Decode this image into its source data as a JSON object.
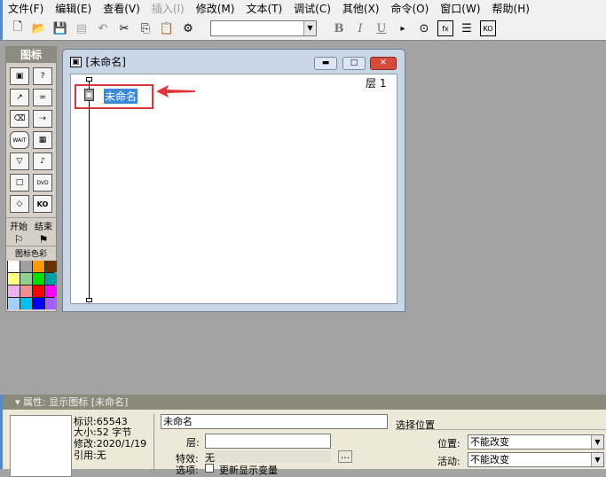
{
  "menu": [
    "文件(F)",
    "编辑(E)",
    "查看(V)",
    "插入(I)",
    "修改(M)",
    "文本(T)",
    "调试(C)",
    "其他(X)",
    "命令(O)",
    "窗口(W)",
    "帮助(H)"
  ],
  "toolbar": {
    "bold": "B",
    "italic": "I",
    "underline": "U",
    "font_value": ""
  },
  "palette": {
    "title": "图标",
    "start": "开始",
    "end": "结束",
    "color_title": "图标色彩",
    "icons": [
      "display",
      "interaction",
      "motion",
      "calculation",
      "erase",
      "navigate",
      "wait",
      "framework",
      "decision",
      "sound",
      "digital-movie",
      "video",
      "map",
      "knowledge-object"
    ],
    "colors": [
      "#ffffff",
      "#a0a0a0",
      "#ff9900",
      "#6b3300",
      "#ffff80",
      "#90d090",
      "#00e000",
      "#00a0a0",
      "#f0b0f0",
      "#f09090",
      "#ff0000",
      "#ff00ff",
      "#a0d0ff",
      "#00c0f0",
      "#0000ff",
      "#a060ff"
    ]
  },
  "flow_window": {
    "title": "[未命名]",
    "layer_label": "层",
    "layer_value": "1",
    "icon_label": "未命名"
  },
  "properties": {
    "header": "属性: 显示图标 [未命名]",
    "id": "标识:65543",
    "size": "大小:52 字节",
    "modified": "修改:2020/1/19",
    "reference": "引用:无",
    "name_value": "未命名",
    "layer_label": "层:",
    "layer_value": "",
    "effect_label": "特效:",
    "effect_value": "无",
    "options_label": "选项:",
    "option_update": "更新显示变量",
    "select_position": "选择位置",
    "position_label": "位置:",
    "position_value": "不能改变",
    "active_label": "活动:",
    "active_value": "不能改变",
    "browse": "..."
  }
}
